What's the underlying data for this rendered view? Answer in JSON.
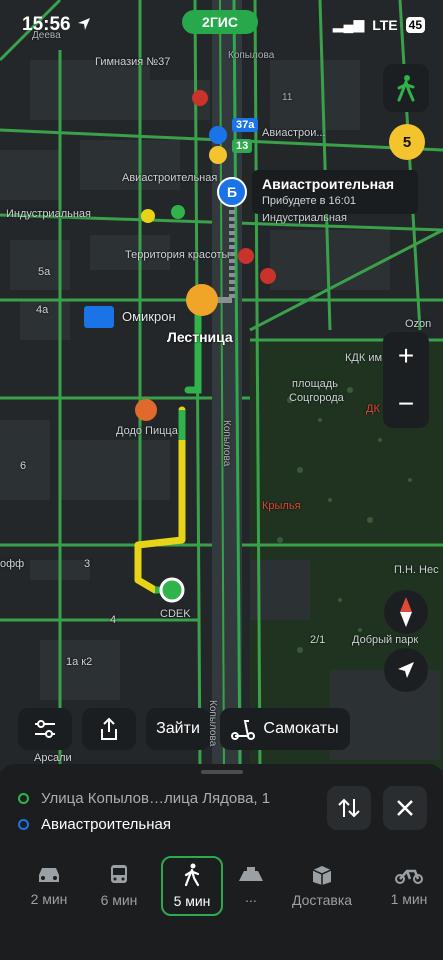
{
  "status_bar": {
    "time": "15:56",
    "network": "LTE",
    "battery": "45"
  },
  "app": {
    "logo_text": "2ГИС"
  },
  "map": {
    "labels": {
      "street_top_left": "Деева",
      "school": "Гимназия №37",
      "kopylova_top": "Копылова",
      "aviastroitelnaya_1": "Авиастрои...",
      "aviastroitelnaya_2": "Авиастроительная",
      "industrialnaya_left": "Индустриальная",
      "industrialnaya_right": "Индустриальная",
      "beauty": "Территория красоты",
      "omikron": "Омикрон",
      "ladder": "Лестница",
      "dodo": "Додо Пицца",
      "kopylova_mid": "Копылова",
      "kopylova_bottom": "Копылова",
      "ploshad": "площадь",
      "soctgoroda": "Соцгорода",
      "kdk": "КДК им",
      "dk_lenina": "ДК Лени",
      "krylya": "Крылья",
      "cdek": "CDEK",
      "pnn": "П.Н. Нес",
      "dobry_park": "Добрый парк",
      "ozon": "Ozon",
      "arsali": "Арсали",
      "house_11": "11",
      "house_6": "6",
      "house_5a": "5а",
      "house_4a": "4а",
      "house_3": "3",
      "house_1ak2": "1а к2",
      "house_2_1": "2/1",
      "house_4": "4",
      "house_3b": "3",
      "ofis": "офф"
    },
    "badges": {
      "bus_37a": "37а",
      "bus_13": "13"
    },
    "destination_pin": "Б",
    "route_card": {
      "title": "Авиастроительная",
      "subtitle": "Прибудете в 16:01"
    },
    "traffic_score": "5"
  },
  "controls": {
    "zoom_in": "+",
    "zoom_out": "−",
    "chip_enter": "Зайти",
    "chip_scooters": "Самокаты"
  },
  "sheet": {
    "from": "Улица Копылов…лица Лядова, 1",
    "to": "Авиастроительная",
    "modes": [
      {
        "icon": "car-icon",
        "label": "2 мин"
      },
      {
        "icon": "bus-icon",
        "label": "6 мин"
      },
      {
        "icon": "walk-icon",
        "label": "5 мин"
      },
      {
        "icon": "taxi-icon",
        "label": "..."
      },
      {
        "icon": "delivery-icon",
        "label": "Доставка"
      },
      {
        "icon": "moto-icon",
        "label": "1 мин"
      }
    ]
  },
  "colors": {
    "route_green": "#2fb34a",
    "route_yellow": "#e8d417",
    "road_green": "#3aa14a",
    "pin_blue": "#1b73e8",
    "metro_red": "#c8332b",
    "score_yellow": "#f3c42d"
  }
}
